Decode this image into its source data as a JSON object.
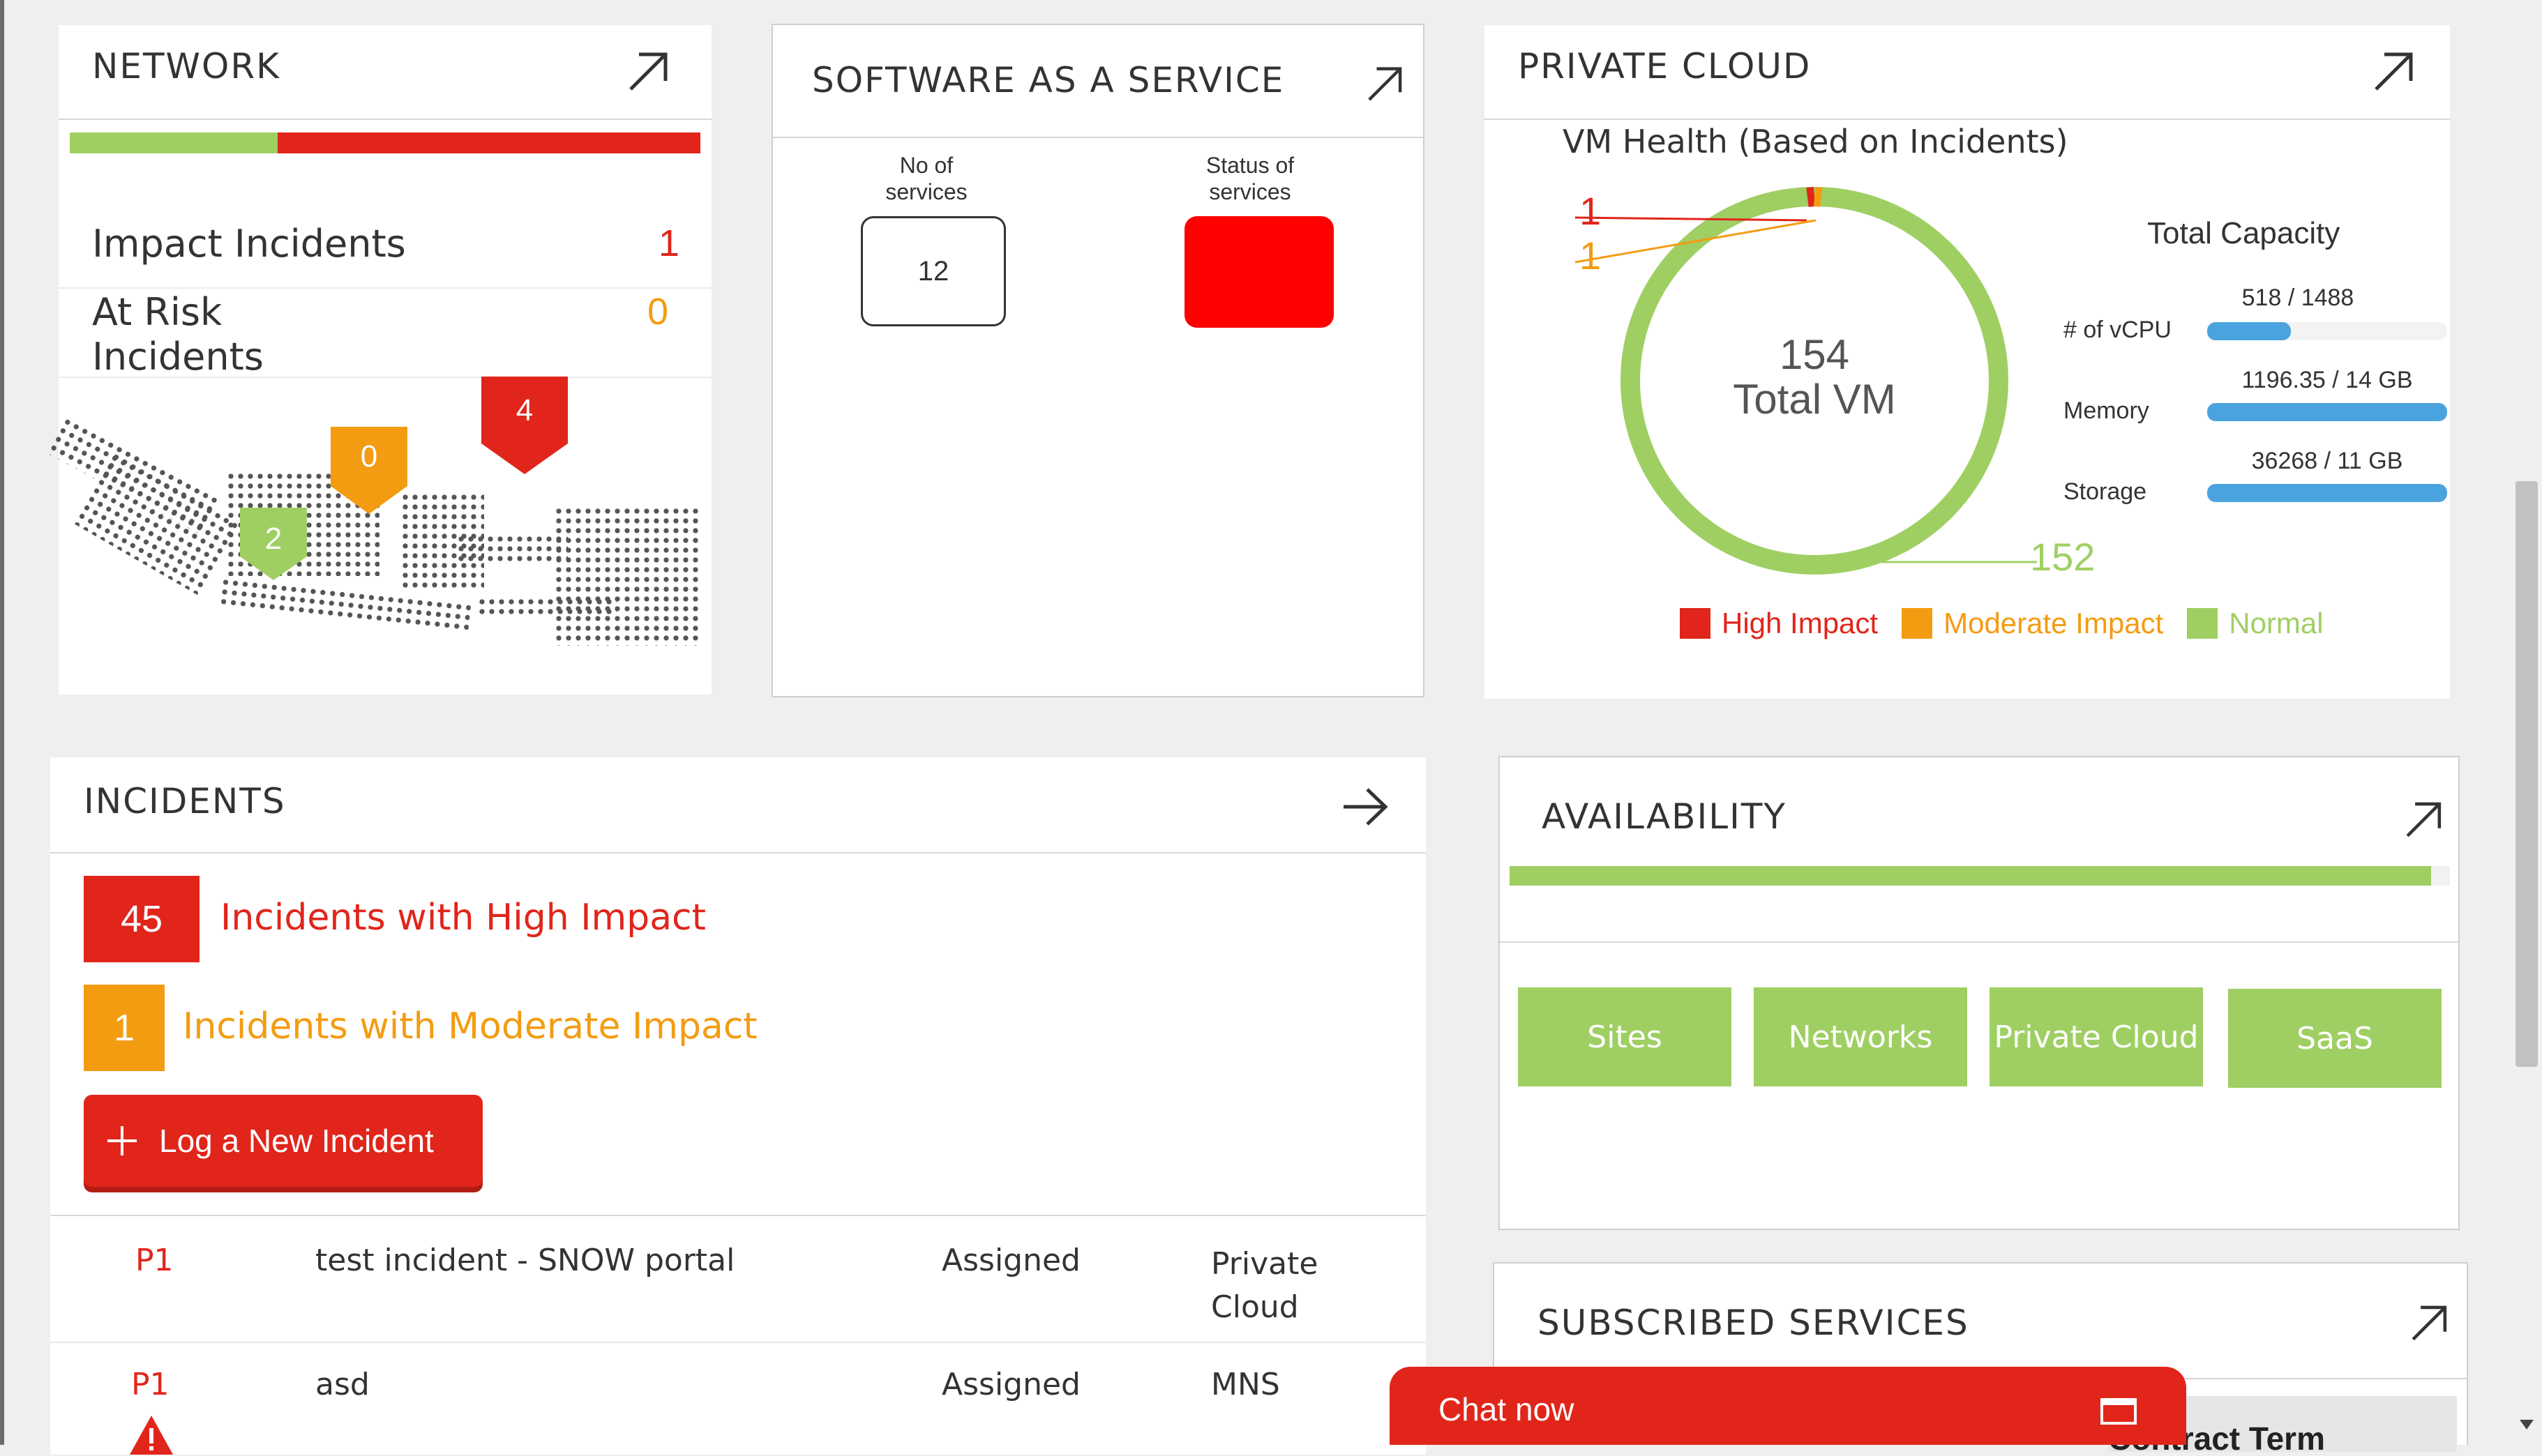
{
  "network": {
    "title": "NETWORK",
    "health_bar": {
      "green_fraction": 0.33,
      "colors": {
        "ok": "#9fcf63",
        "bad": "#e1251b"
      }
    },
    "impact_label": "Impact Incidents",
    "impact_value": "1",
    "risk_label_line1": "At Risk",
    "risk_label_line2": "Incidents",
    "risk_value": "0",
    "map_markers": [
      {
        "value": "0",
        "color": "#f39c12"
      },
      {
        "value": "4",
        "color": "#e1251b"
      },
      {
        "value": "2",
        "color": "#9fcf63"
      }
    ]
  },
  "saas": {
    "title": "SOFTWARE AS A SERVICE",
    "col1_line1": "No of",
    "col1_line2": "services",
    "col2_line1": "Status of",
    "col2_line2": "services",
    "services_count": "12",
    "status_color": "#ff0000"
  },
  "private_cloud": {
    "title": "PRIVATE CLOUD",
    "vm_health_label": "VM Health (Based on Incidents)",
    "donut_center_value": "154",
    "donut_center_label": "Total VM",
    "callouts": {
      "high": "1",
      "moderate": "1",
      "normal": "152"
    },
    "total_capacity_label": "Total Capacity",
    "capacity": [
      {
        "label": "# of vCPU",
        "value": "518 / 1488",
        "fill": 0.35
      },
      {
        "label": "Memory",
        "value": "1196.35 / 14 GB",
        "fill": 1.0
      },
      {
        "label": "Storage",
        "value": "36268 / 11 GB",
        "fill": 1.0
      }
    ],
    "legend": [
      {
        "label": "High Impact",
        "color": "#e1251b"
      },
      {
        "label": "Moderate Impact",
        "color": "#f39c12"
      },
      {
        "label": "Normal",
        "color": "#9fcf63"
      }
    ]
  },
  "incidents": {
    "title": "INCIDENTS",
    "high_count": "45",
    "high_label": "Incidents with High Impact",
    "moderate_count": "1",
    "moderate_label": "Incidents with Moderate Impact",
    "log_button_label": "Log a New Incident",
    "rows": [
      {
        "priority": "P1",
        "title": "test incident - SNOW portal",
        "status": "Assigned",
        "service_line1": "Private",
        "service_line2": "Cloud"
      },
      {
        "priority": "P1",
        "title": "asd",
        "status": "Assigned",
        "service_line1": "MNS",
        "service_line2": ""
      }
    ]
  },
  "availability": {
    "title": "AVAILABILITY",
    "bar_fill": 0.98,
    "buttons": [
      "Sites",
      "Networks",
      "Private Cloud",
      "SaaS"
    ]
  },
  "subscribed": {
    "title": "SUBSCRIBED SERVICES",
    "partial_text": "Contract Term"
  },
  "chat": {
    "label": "Chat now"
  }
}
